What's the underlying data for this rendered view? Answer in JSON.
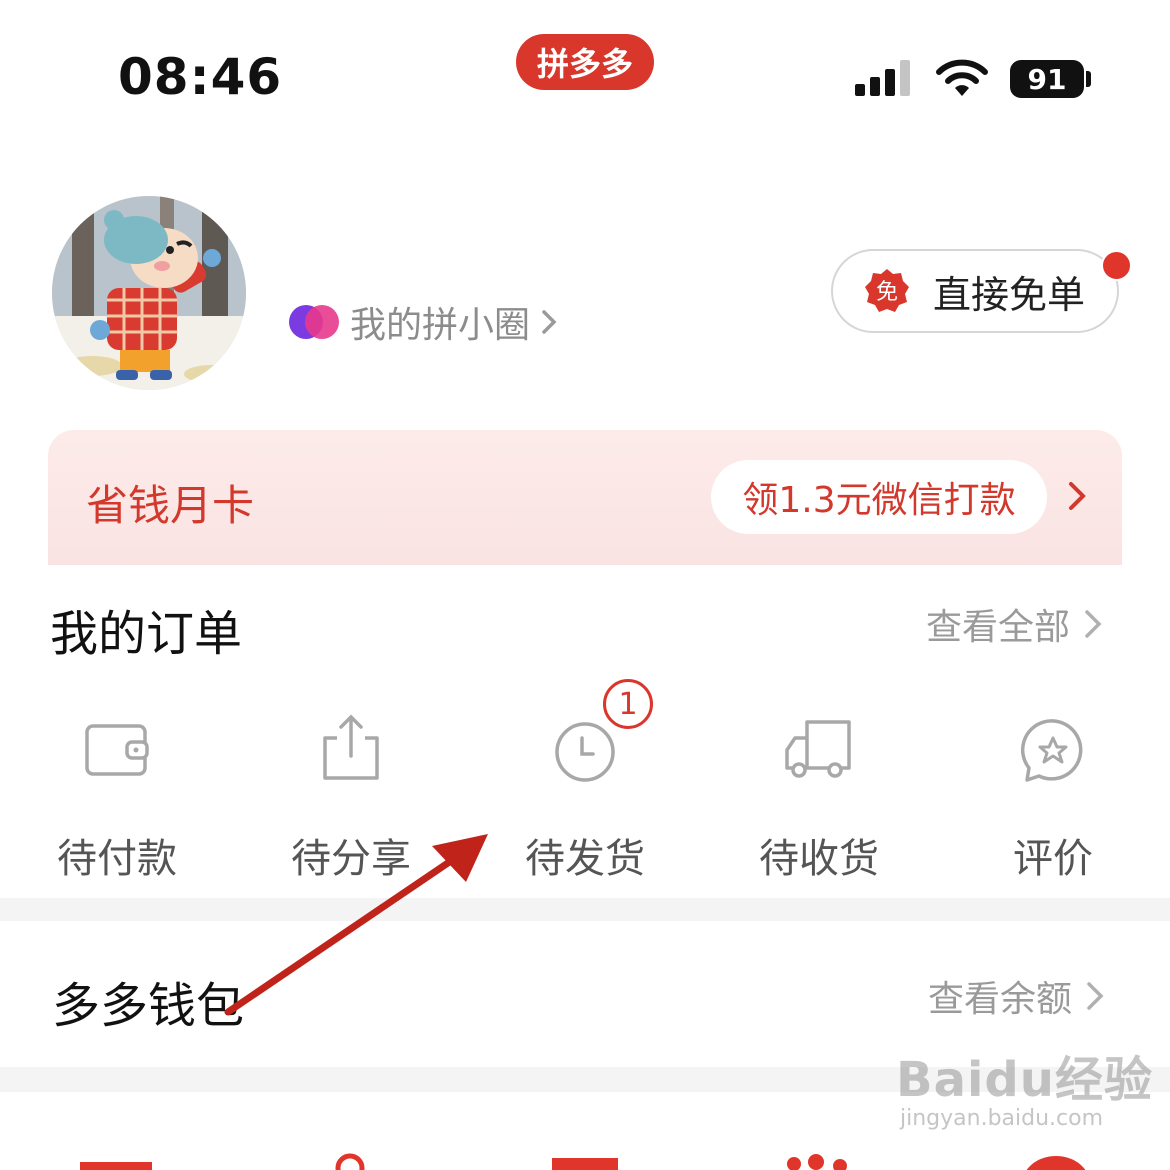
{
  "status_bar": {
    "time": "08:46",
    "app_name": "拼多多",
    "battery": "91"
  },
  "profile": {
    "circle_link": "我的拼小圈",
    "free_order_badge_char": "免",
    "free_order_button": "直接免单"
  },
  "monthly_card": {
    "title": "省钱月卡",
    "promo": "领1.3元微信打款"
  },
  "orders": {
    "title": "我的订单",
    "view_all": "查看全部",
    "items": [
      {
        "label": "待付款",
        "icon": "wallet-icon"
      },
      {
        "label": "待分享",
        "icon": "share-icon"
      },
      {
        "label": "待发货",
        "icon": "clock-icon",
        "badge": "1"
      },
      {
        "label": "待收货",
        "icon": "truck-icon"
      },
      {
        "label": "评价",
        "icon": "review-star-icon"
      }
    ]
  },
  "wallet": {
    "title": "多多钱包",
    "view_balance": "查看余额"
  },
  "watermark": {
    "main": "Baidu经验",
    "sub": "jingyan.baidu.com"
  },
  "colors": {
    "brand_red": "#d9372b",
    "card_pink": "#fdebea",
    "annotation_arrow": "#c0231a"
  }
}
